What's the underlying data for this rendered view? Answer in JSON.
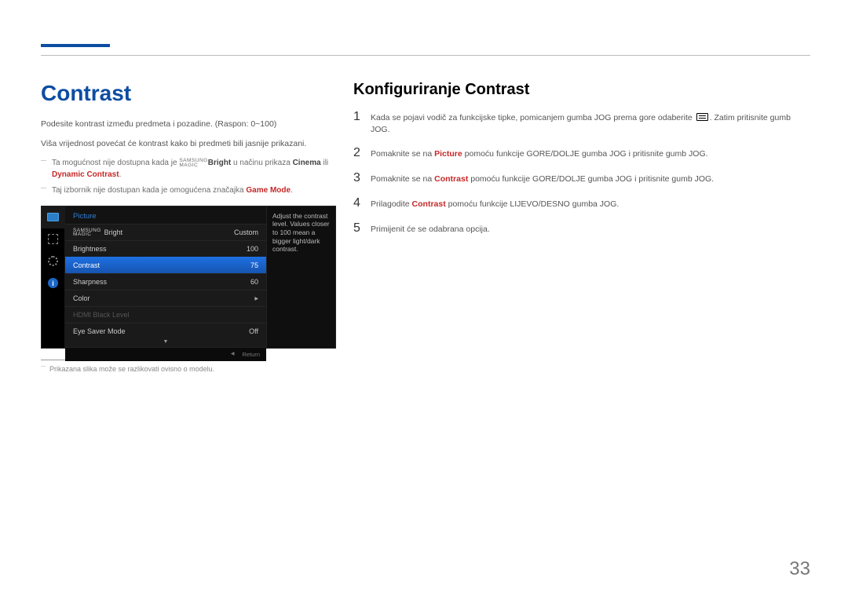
{
  "header": {
    "title": "Contrast"
  },
  "left": {
    "p1": "Podesite kontrast između predmeta i pozadine. (Raspon: 0~100)",
    "p2": "Viša vrijednost povećat će kontrast kako bi predmeti bili jasnije prikazani.",
    "note1_a": "Ta mogućnost nije dostupna kada je ",
    "note1_brand_top": "SAMSUNG",
    "note1_brand_bot": "MAGIC",
    "note1_brand_suffix": "Bright",
    "note1_b": " u načinu prikaza ",
    "note1_cinema": "Cinema",
    "note1_c": " ili ",
    "note1_dyn": "Dynamic Contrast",
    "note1_d": ".",
    "note2_a": "Taj izbornik nije dostupan kada je omogućena značajka ",
    "note2_gm": "Game Mode",
    "note2_b": ".",
    "footnote": "Prikazana slika može se razlikovati ovisno o modelu."
  },
  "osd": {
    "head": "Picture",
    "rows": {
      "magic_top": "SAMSUNG",
      "magic_bot": "MAGIC",
      "magic_suffix": "Bright",
      "magic_val": "Custom",
      "brightness": "Brightness",
      "brightness_val": "100",
      "contrast": "Contrast",
      "contrast_val": "75",
      "sharpness": "Sharpness",
      "sharpness_val": "60",
      "color": "Color",
      "hdmi": "HDMI Black Level",
      "eye": "Eye Saver Mode",
      "eye_val": "Off"
    },
    "help": "Adjust the contrast level. Values closer to 100 mean a bigger light/dark contrast.",
    "return": "Return"
  },
  "right": {
    "title": "Konfiguriranje Contrast",
    "s1_a": "Kada se pojavi vodič za funkcijske tipke, pomicanjem gumba JOG prema gore odaberite ",
    "s1_b": ". Zatim pritisnite gumb JOG.",
    "s2_a": "Pomaknite se na ",
    "s2_pic": "Picture",
    "s2_b": " pomoću funkcije GORE/DOLJE gumba JOG i pritisnite gumb JOG.",
    "s3_a": "Pomaknite se na ",
    "s3_con": "Contrast",
    "s3_b": " pomoću funkcije GORE/DOLJE gumba JOG i pritisnite gumb JOG.",
    "s4_a": "Prilagodite ",
    "s4_con": "Contrast",
    "s4_b": " pomoću funkcije LIJEVO/DESNO gumba JOG.",
    "s5": "Primijenit će se odabrana opcija."
  },
  "page_number": "33"
}
